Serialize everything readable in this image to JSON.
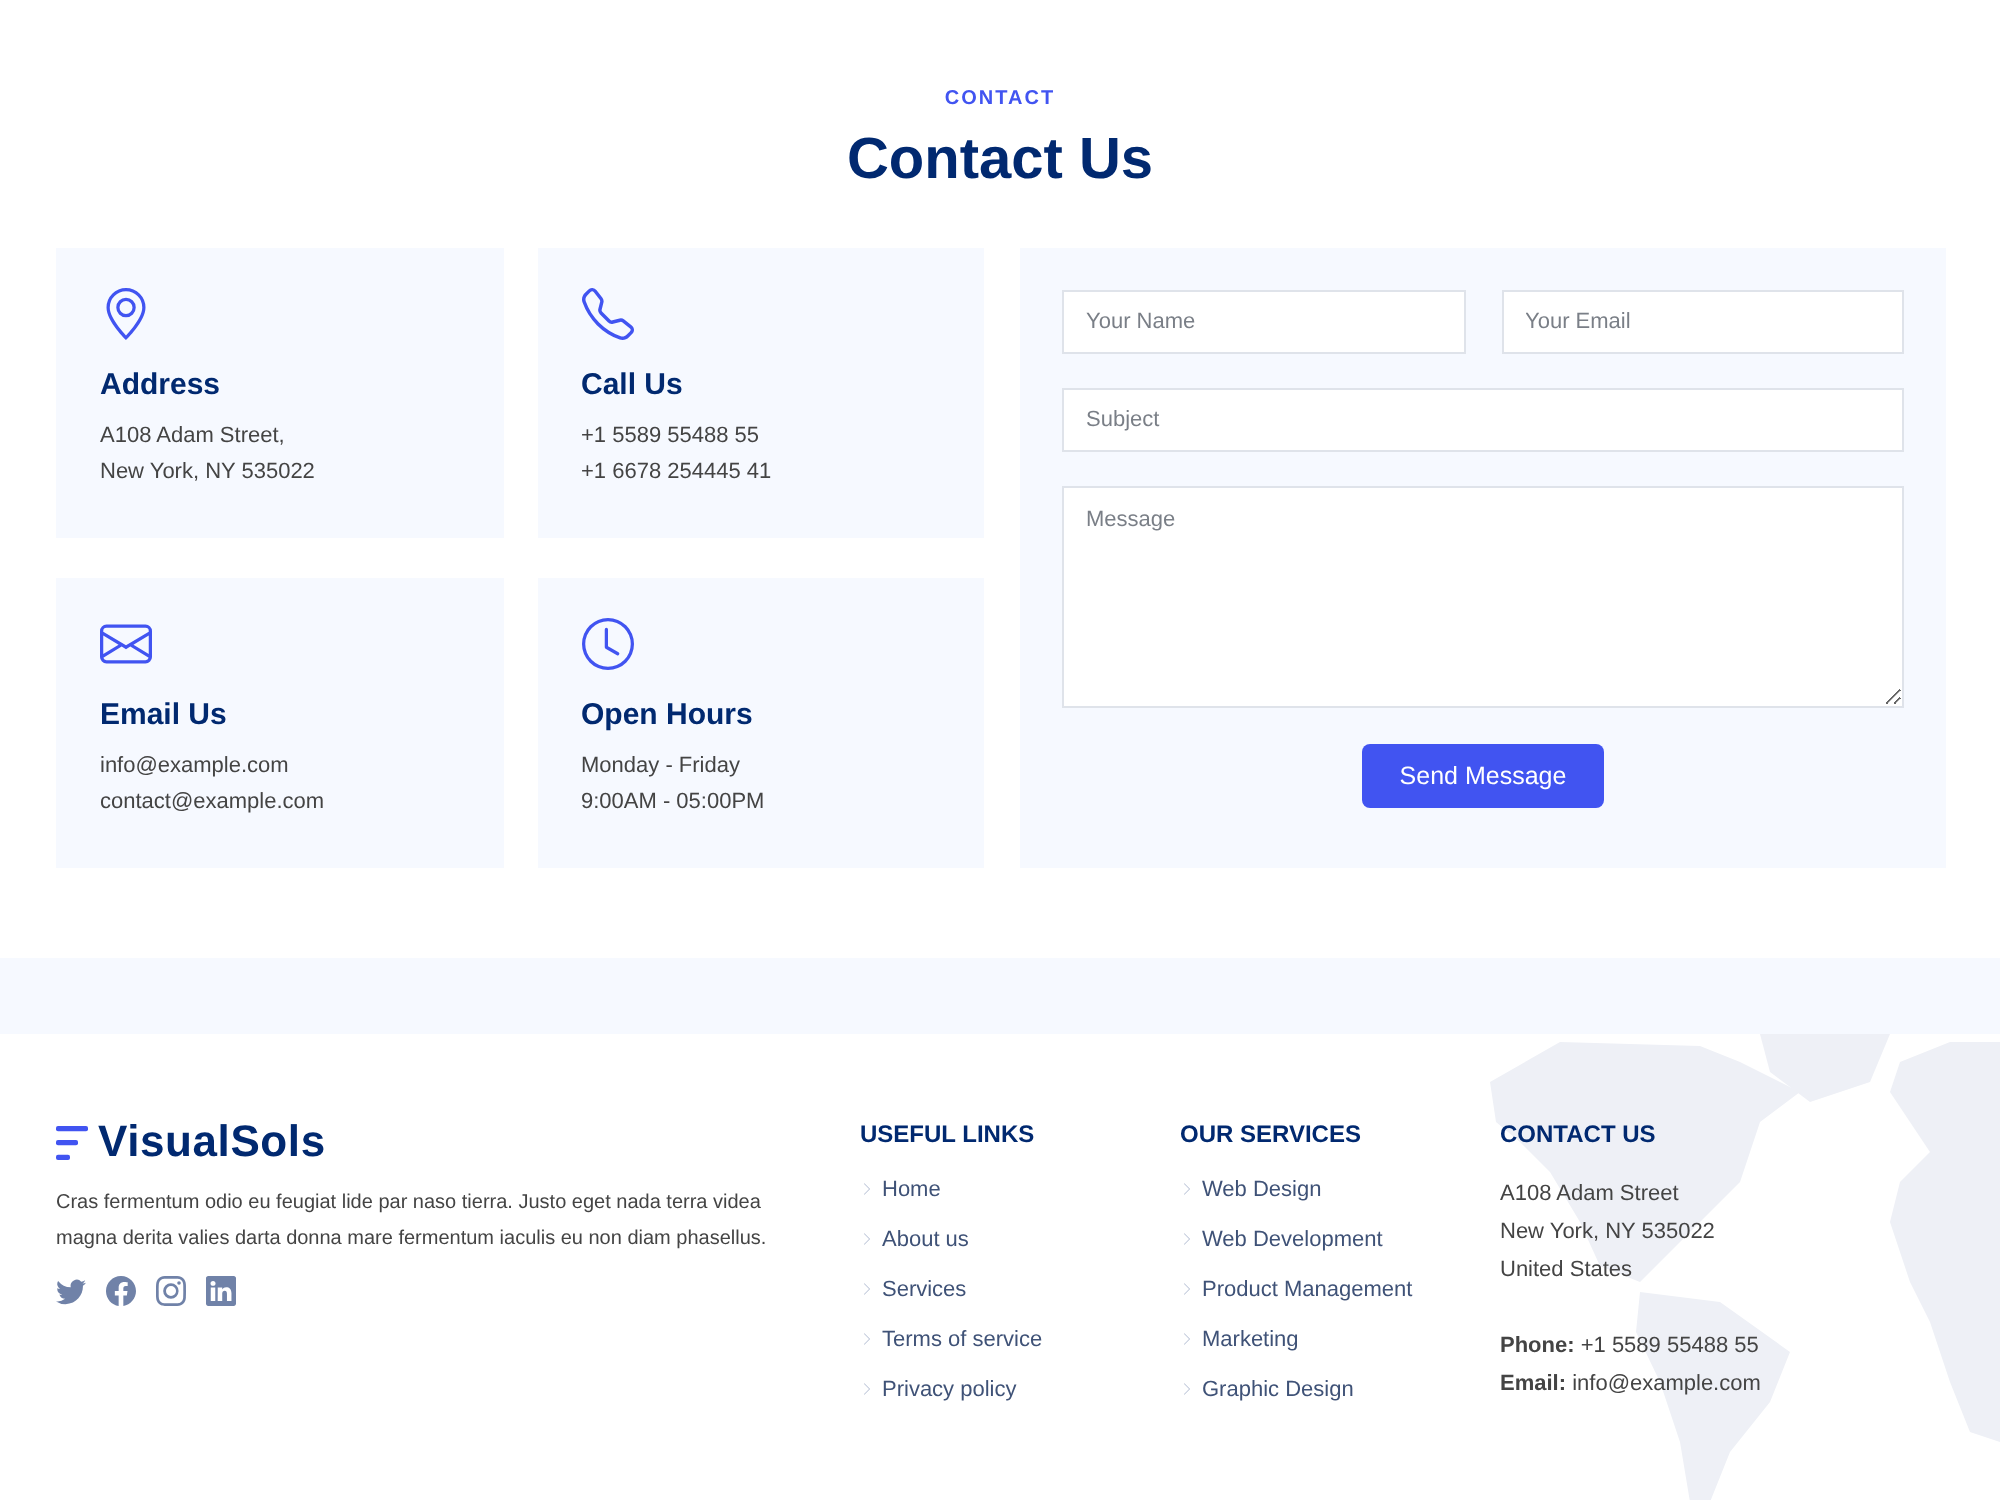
{
  "section": {
    "eyebrow": "CONTACT",
    "title": "Contact Us"
  },
  "info_cards": [
    {
      "kind": "address",
      "title": "Address",
      "lines": [
        "A108 Adam Street,",
        "New York, NY 535022"
      ]
    },
    {
      "kind": "phone",
      "title": "Call Us",
      "lines": [
        "+1 5589 55488 55",
        "+1 6678 254445 41"
      ]
    },
    {
      "kind": "email",
      "title": "Email Us",
      "lines": [
        "info@example.com",
        "contact@example.com"
      ]
    },
    {
      "kind": "clock",
      "title": "Open Hours",
      "lines": [
        "Monday - Friday",
        "9:00AM - 05:00PM"
      ]
    }
  ],
  "form": {
    "name_field": {
      "placeholder": "Your Name"
    },
    "email_field": {
      "placeholder": "Your Email"
    },
    "subject_field": {
      "placeholder": "Subject"
    },
    "message_field": {
      "placeholder": "Message"
    },
    "submit": "Send Message"
  },
  "footer": {
    "logo": "VisualSols",
    "about": "Cras fermentum odio eu feugiat lide par naso tierra. Justo eget nada terra videa magna derita valies darta donna mare fermentum iaculis eu non diam phasellus.",
    "social": [
      {
        "kind": "twitter"
      },
      {
        "kind": "facebook"
      },
      {
        "kind": "instagram"
      },
      {
        "kind": "linkedin"
      }
    ],
    "useful_links": {
      "title": "USEFUL LINKS",
      "items": [
        "Home",
        "About us",
        "Services",
        "Terms of service",
        "Privacy policy"
      ]
    },
    "services": {
      "title": "OUR SERVICES",
      "items": [
        "Web Design",
        "Web Development",
        "Product Management",
        "Marketing",
        "Graphic Design"
      ]
    },
    "contact": {
      "title": "CONTACT US",
      "address_lines": [
        "A108 Adam Street",
        "New York, NY 535022",
        "United States"
      ],
      "phone_label": "Phone:",
      "phone": "+1 5589 55488 55",
      "email_label": "Email:",
      "email": "info@example.com"
    }
  }
}
